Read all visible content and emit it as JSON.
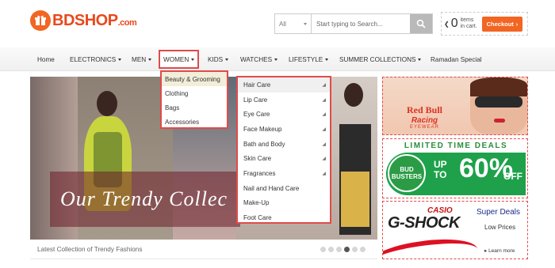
{
  "header": {
    "logo_text": "BDSHOP",
    "logo_domain": ".com",
    "search_category": "All",
    "search_placeholder": "Start typing to Search...",
    "cart_count": "0",
    "cart_text_1": "items",
    "cart_text_2": "in cart.",
    "checkout_label": "Checkout"
  },
  "nav": {
    "items": [
      {
        "label": "Home"
      },
      {
        "label": "ELECTRONICS"
      },
      {
        "label": "MEN"
      },
      {
        "label": "WOMEN"
      },
      {
        "label": "KIDS"
      },
      {
        "label": "WATCHES"
      },
      {
        "label": "LIFESTYLE"
      },
      {
        "label": "SUMMER COLLECTIONS"
      },
      {
        "label": "Ramadan Special"
      }
    ]
  },
  "women_menu": [
    {
      "label": "Beauty & Grooming"
    },
    {
      "label": "Clothing"
    },
    {
      "label": "Bags"
    },
    {
      "label": "Accessories"
    }
  ],
  "beauty_menu": [
    {
      "label": "Hair Care"
    },
    {
      "label": "Lip Care"
    },
    {
      "label": "Eye Care"
    },
    {
      "label": "Face Makeup"
    },
    {
      "label": "Bath and Body"
    },
    {
      "label": "Skin Care"
    },
    {
      "label": "Fragrances"
    },
    {
      "label": "Nail and Hand Care"
    },
    {
      "label": "Make-Up"
    },
    {
      "label": "Foot Care"
    }
  ],
  "banner": {
    "script_text": "Our Trendy Collec",
    "caption": "Latest Collection of Trendy Fashions"
  },
  "ads": {
    "redbull": {
      "line1": "Red Bull",
      "line2": "Racing",
      "line3": "EYEWEAR"
    },
    "deals": {
      "title": "LIMITED TIME DEALS",
      "badge_1": "BUD",
      "badge_2": "BUSTERS",
      "upto_1": "UP",
      "upto_2": "TO",
      "percent": "60%",
      "off": "OFF"
    },
    "gshock": {
      "casio": "CASIO",
      "brand": "G-SHOCK",
      "super": "Super Deals",
      "low": "Low Prices",
      "learn": "▸ Learn more"
    }
  },
  "colors": {
    "brand_orange": "#f26522",
    "highlight_red": "#e04b4b",
    "deals_green": "#1ea14a"
  }
}
